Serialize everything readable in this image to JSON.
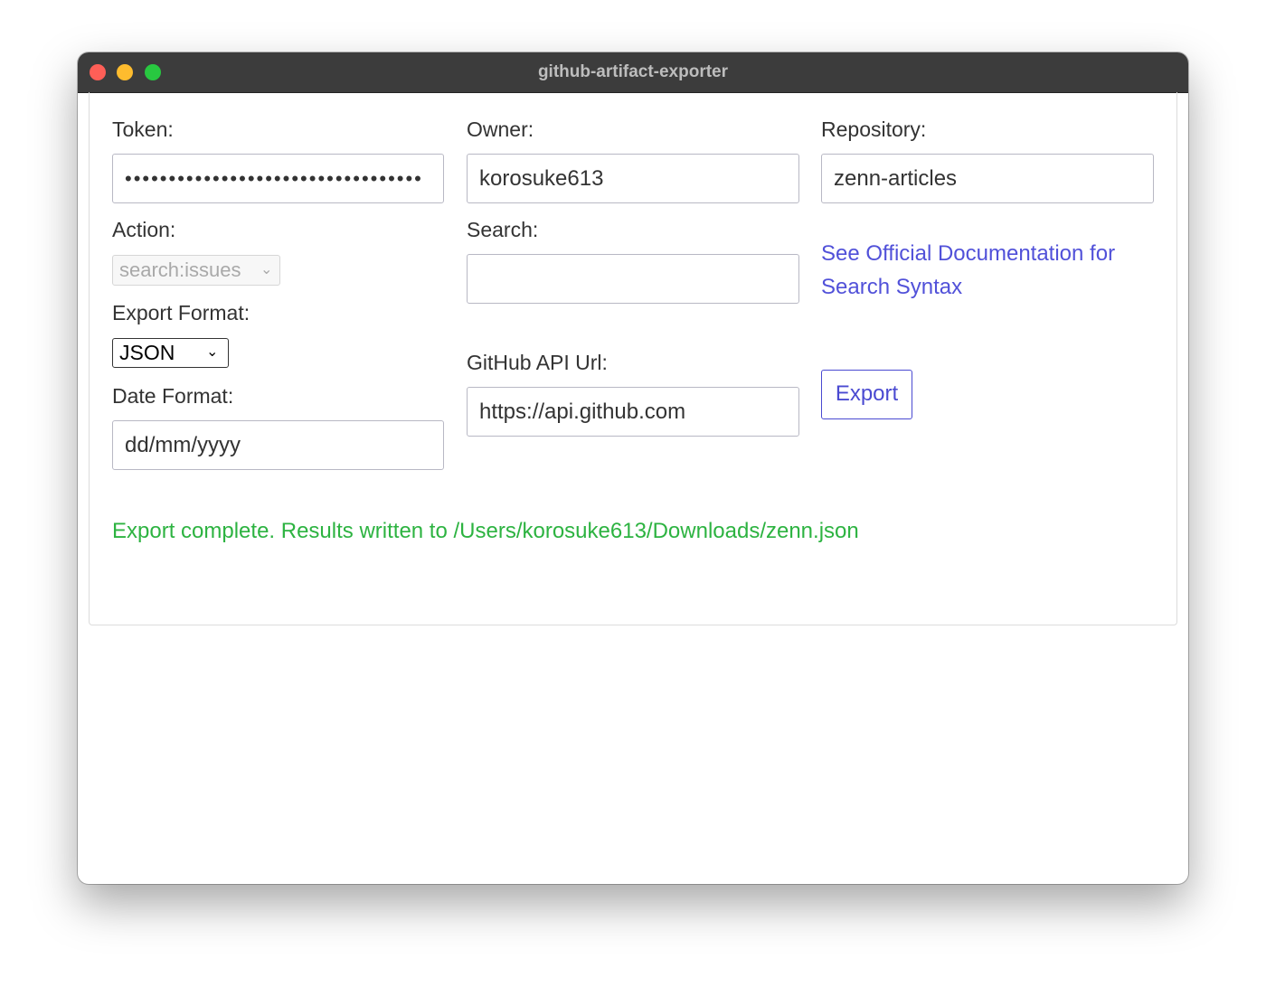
{
  "window": {
    "title": "github-artifact-exporter"
  },
  "form": {
    "token": {
      "label": "Token:",
      "value": "••••••••••••••••••••••••••••••••••"
    },
    "owner": {
      "label": "Owner:",
      "value": "korosuke613"
    },
    "repository": {
      "label": "Repository:",
      "value": "zenn-articles"
    },
    "action": {
      "label": "Action:",
      "value": "search:issues"
    },
    "search": {
      "label": "Search:",
      "value": ""
    },
    "docs_link": {
      "line1": "See Official Documentation for",
      "line2": "Search Syntax"
    },
    "export_format": {
      "label": "Export Format:",
      "value": "JSON"
    },
    "api_url": {
      "label": "GitHub API Url:",
      "value": "https://api.github.com"
    },
    "export_button": "Export",
    "date_format": {
      "label": "Date Format:",
      "value": "dd/mm/yyyy"
    }
  },
  "status": {
    "message": "Export complete. Results written to /Users/korosuke613/Downloads/zenn.json",
    "color": "#2db341"
  },
  "colors": {
    "link": "#5151d9",
    "titlebar": "#3c3c3c",
    "traffic_close": "#fe5f57",
    "traffic_minimize": "#febc2e",
    "traffic_maximize": "#28c840"
  }
}
